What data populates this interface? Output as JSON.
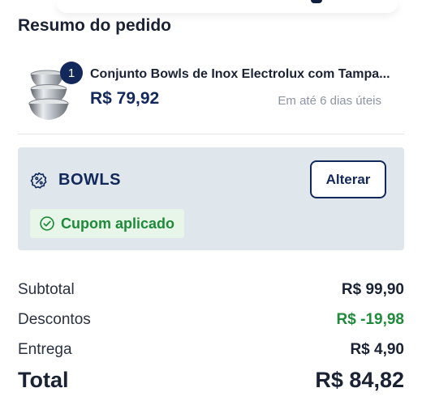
{
  "summary": {
    "title": "Resumo do pedido"
  },
  "product": {
    "quantity": "1",
    "name": "Conjunto Bowls de Inox Electrolux com Tampa...",
    "price": "R$ 79,92",
    "delivery": "Em até 6 dias úteis",
    "image_icon": "steel-bowls-image"
  },
  "coupon": {
    "icon": "percent-badge-icon",
    "code": "BOWLS",
    "change_label": "Alterar",
    "applied_icon": "check-circle-icon",
    "applied_label": "Cupom aplicado"
  },
  "totals": {
    "subtotal_label": "Subtotal",
    "subtotal_value": "R$ 99,90",
    "discount_label": "Descontos",
    "discount_value": "R$ -19,98",
    "shipping_label": "Entrega",
    "shipping_value": "R$ 4,90",
    "total_label": "Total",
    "total_value": "R$ 84,82"
  },
  "colors": {
    "primary": "#13285a",
    "success": "#1e8a3a",
    "coupon_bg": "#dfe6ec",
    "applied_bg": "#e8f5e9",
    "muted": "#8c94a3"
  }
}
